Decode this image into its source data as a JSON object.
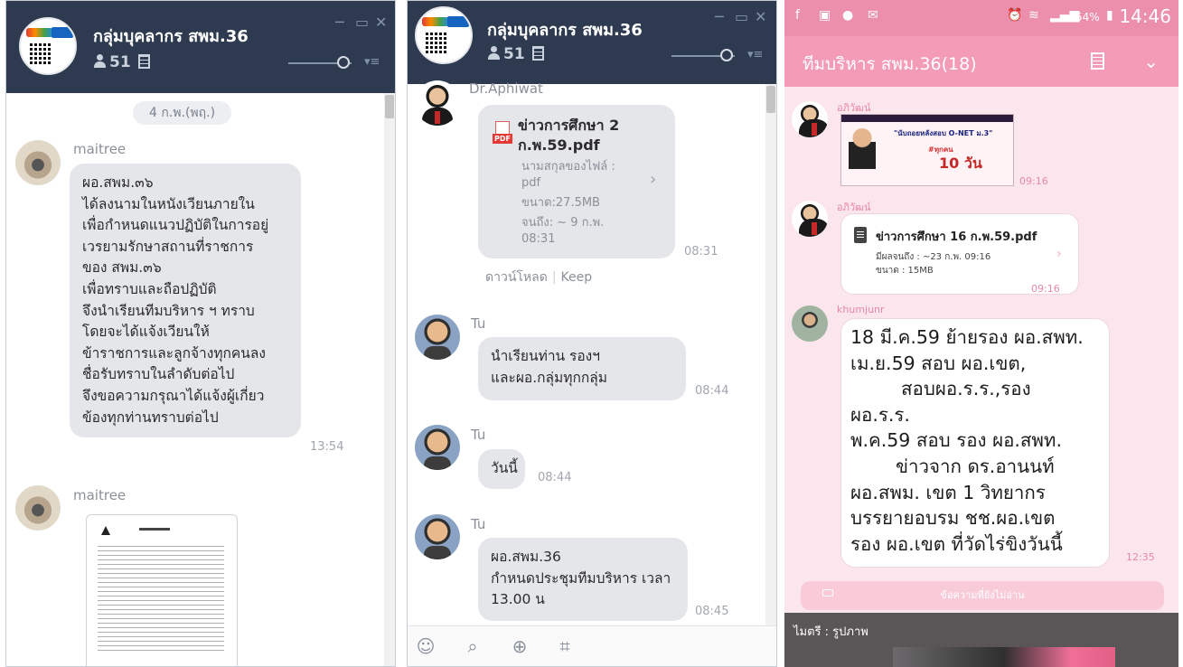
{
  "left_panel": {
    "group_name": "กลุ่มบุคลากร สพม.36",
    "member_count": "51",
    "date_label": "4 ก.พ.(พฤ.)",
    "messages": [
      {
        "sender": "maitree",
        "lines": [
          "ผอ.สพม.๓๖",
          "ได้ลงนามในหนังเวียนภายใน",
          "เพื่อกำหนดแนวปฏิบัติในการอยู่",
          "เวรยามรักษาสถานที่ราชการ",
          "ของ สพม.๓๖",
          "เพื่อทราบและถือปฏิบัติ",
          "จึงนำเรียนทีมบริหาร ฯ ทราบ",
          "โดยจะได้แจ้งเวียนให้",
          "ข้าราชการและลูกจ้างทุกคนลง",
          "ชื่อรับทราบในลำดับต่อไป",
          "จึงขอความกรุณาได้แจ้งผู้เกี่ยว",
          "ข้องทุกท่านทราบต่อไป"
        ],
        "time": "13:54"
      },
      {
        "sender": "maitree",
        "attachment": "document-image"
      }
    ]
  },
  "middle_panel": {
    "group_name": "กลุ่มบุคลากร สพม.36",
    "member_count": "51",
    "file_message": {
      "sender": "Dr.Aphiwat",
      "file_name_lines": [
        "ข่าวการศึกษา 2",
        "ก.พ.59.pdf"
      ],
      "meta_lines": [
        "นามสกุลของไฟล์ :",
        "pdf",
        "ขนาด:27.5MB",
        "จนถึง: ~ 9 ก.พ.",
        "08:31"
      ],
      "time": "08:31",
      "download_label": "ดาวน์โหลด",
      "keep_label": "Keep"
    },
    "messages": [
      {
        "sender": "Tu",
        "lines": [
          "นำเรียนท่าน รองฯ",
          "และผอ.กลุ่มทุกกลุ่ม"
        ],
        "time": "08:44"
      },
      {
        "sender": "Tu",
        "lines": [
          "วันนี้"
        ],
        "time": "08:44"
      },
      {
        "sender": "Tu",
        "lines": [
          "ผอ.สพม.36",
          "กำหนดประชุมทีมบริหาร เวลา",
          "13.00 น"
        ],
        "time": "08:45"
      }
    ],
    "toolbar_icons": [
      "emoji-icon",
      "attach-icon",
      "save-icon",
      "crop-icon"
    ]
  },
  "right_panel": {
    "status_bar": {
      "battery": "54%",
      "clock": "14:46"
    },
    "chat_title": "ทีมบริหาร สพม.36(18)",
    "messages": [
      {
        "sender": "อภิวัฒน์",
        "image_text": [
          "\"นับถอยหลังสอบ O-NET ม.3\"",
          "#ทุกคน",
          "10 วัน"
        ],
        "time": "09:16"
      },
      {
        "sender": "อภิวัฒน์",
        "file_name": "ข่าวการศึกษา 16 ก.พ.59.pdf",
        "meta_lines": [
          "มีผลจนถึง : ~23 ก.พ. 09:16",
          "ขนาด : 15MB"
        ],
        "time": "09:16"
      },
      {
        "sender": "khumjunr",
        "lines": [
          "18 มี.ค.59 ย้ายรอง ผอ.สพท.",
          "เม.ย.59 สอบ ผอ.เขต,",
          "       สอบผอ.ร.ร.,รอง",
          "ผอ.ร.ร.",
          "พ.ค.59  สอบ รอง ผอ.สพท.",
          "       ข่าวจาก ดร.อานนท์",
          "ผอ.สพม. เขต 1 วิทยากร",
          "บรรยายอบรม ชช.ผอ.เขต",
          "รอง ผอ.เขต ที่วัดไร่ขิงวันนี้"
        ],
        "time": "12:35"
      }
    ],
    "unread_label": "ข้อความที่ยังไม่อ่าน",
    "bottom_label": "ไมตรี : รูปภาพ"
  }
}
